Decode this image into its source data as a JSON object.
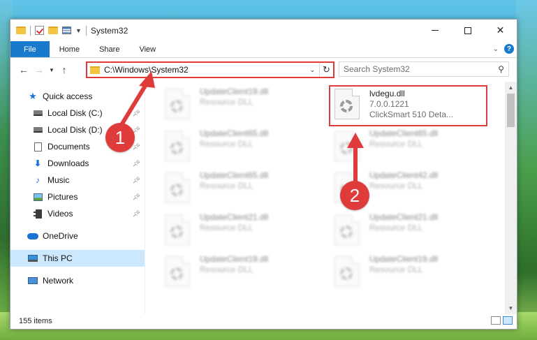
{
  "window": {
    "title": "System32"
  },
  "ribbon": {
    "tabs": [
      "File",
      "Home",
      "Share",
      "View"
    ]
  },
  "address": {
    "path": "C:\\Windows\\System32"
  },
  "search": {
    "placeholder": "Search System32"
  },
  "sidebar": {
    "items": [
      {
        "label": "Quick access",
        "icon": "star-icon"
      },
      {
        "label": "Local Disk (C:)",
        "icon": "drive-icon",
        "pinned": true
      },
      {
        "label": "Local Disk (D:)",
        "icon": "drive-icon",
        "pinned": true
      },
      {
        "label": "Documents",
        "icon": "document-icon",
        "pinned": true
      },
      {
        "label": "Downloads",
        "icon": "download-icon",
        "pinned": true
      },
      {
        "label": "Music",
        "icon": "music-icon",
        "pinned": true
      },
      {
        "label": "Pictures",
        "icon": "pictures-icon",
        "pinned": true
      },
      {
        "label": "Videos",
        "icon": "videos-icon",
        "pinned": true
      },
      {
        "label": "OneDrive",
        "icon": "cloud-icon"
      },
      {
        "label": "This PC",
        "icon": "computer-icon",
        "selected": true
      },
      {
        "label": "Network",
        "icon": "network-icon"
      }
    ]
  },
  "files": {
    "left": [
      {
        "name": "UpdateClient19.dll",
        "type": "Resource DLL"
      },
      {
        "name": "UpdateClient65.dll",
        "type": "Resource DLL"
      },
      {
        "name": "UpdateClient65.dll",
        "type": "Resource DLL"
      },
      {
        "name": "UpdateClient21.dll",
        "type": "Resource DLL"
      },
      {
        "name": "UpdateClient19.dll",
        "type": "Resource DLL"
      }
    ],
    "right": [
      {
        "name": "UpdateClient65.dll",
        "type": "Resource DLL"
      },
      {
        "name": "UpdateClient42.dll",
        "type": "Resource DLL"
      },
      {
        "name": "UpdateClient21.dll",
        "type": "Resource DLL"
      },
      {
        "name": "UpdateClient19.dll",
        "type": "Resource DLL"
      }
    ],
    "highlighted": {
      "name": "lvdegu.dll",
      "version": "7.0.0.1221",
      "description": "ClickSmart 510 Deta..."
    }
  },
  "status": {
    "count": "155 items"
  },
  "annotations": {
    "step1": "1",
    "step2": "2",
    "color": "#e03b3b"
  }
}
